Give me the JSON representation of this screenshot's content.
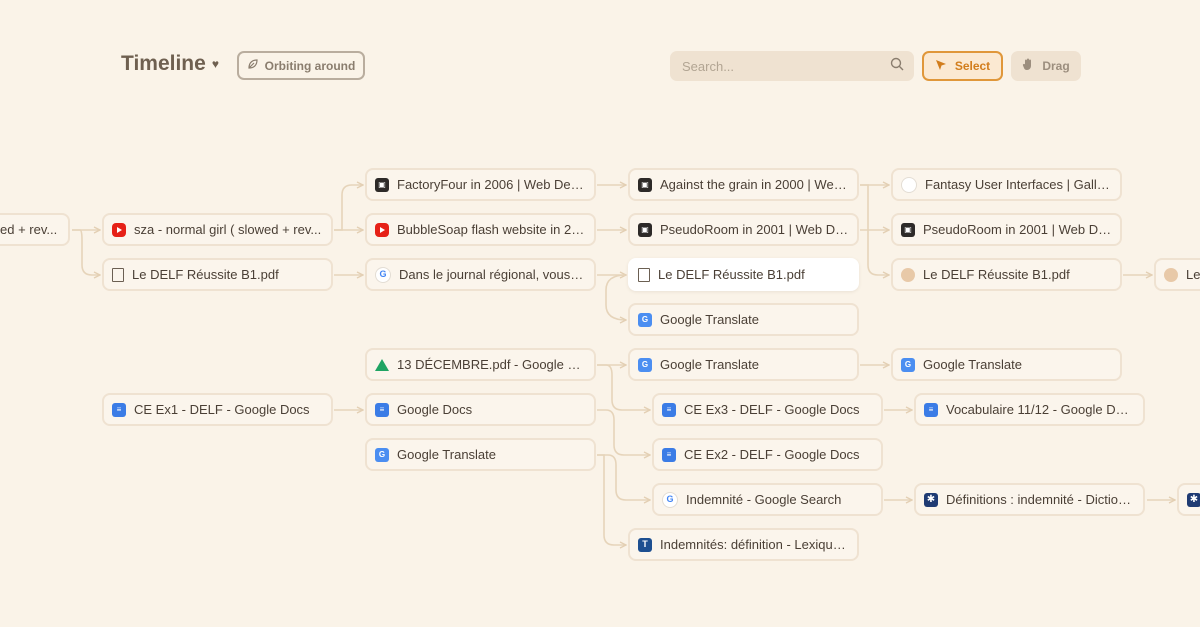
{
  "header": {
    "title": "Timeline",
    "orbit_label": "Orbiting around",
    "search_placeholder": "Search...",
    "select_label": "Select",
    "drag_label": "Drag"
  },
  "nodes": [
    {
      "label": "ed + rev...",
      "icon": "none"
    },
    {
      "label": "sza - normal girl ( slowed + rev...",
      "icon": "youtube-icon"
    },
    {
      "label": "Le DELF Réussite B1.pdf",
      "icon": "file-icon"
    },
    {
      "label": "FactoryFour in 2006 | Web Desi...",
      "icon": "web-design-museum-icon"
    },
    {
      "label": "BubbleSoap flash website in 20...",
      "icon": "youtube-icon"
    },
    {
      "label": "Dans le journal régional, vous lis...",
      "icon": "google-icon"
    },
    {
      "label": "Against the grain in 2000 | Web...",
      "icon": "web-design-museum-icon"
    },
    {
      "label": "PseudoRoom in 2001 | Web Des...",
      "icon": "web-design-museum-icon"
    },
    {
      "label": "Le DELF Réussite B1.pdf",
      "icon": "file-icon"
    },
    {
      "label": "Google Translate",
      "icon": "google-translate-icon"
    },
    {
      "label": "Fantasy User Interfaces | Galler...",
      "icon": "faint-globe-icon"
    },
    {
      "label": "PseudoRoom in 2001 | Web Des...",
      "icon": "web-design-museum-icon"
    },
    {
      "label": "Le DELF Réussite B1.pdf",
      "icon": "avatar-icon"
    },
    {
      "label": "Le",
      "icon": "avatar-icon"
    },
    {
      "label": "13 DÉCEMBRE.pdf - Google Drive",
      "icon": "google-drive-icon"
    },
    {
      "label": "Google Translate",
      "icon": "google-translate-icon"
    },
    {
      "label": "Google Translate",
      "icon": "google-translate-icon"
    },
    {
      "label": "CE Ex1 - DELF - Google Docs",
      "icon": "google-docs-icon"
    },
    {
      "label": "Google Docs",
      "icon": "google-docs-icon"
    },
    {
      "label": "CE Ex3 - DELF - Google Docs",
      "icon": "google-docs-icon"
    },
    {
      "label": "Vocabulaire 11/12 - Google Docs",
      "icon": "google-docs-icon"
    },
    {
      "label": "CE Ex2 - DELF - Google Docs",
      "icon": "google-docs-icon"
    },
    {
      "label": "Google Translate",
      "icon": "google-translate-icon"
    },
    {
      "label": "Indemnité - Google Search",
      "icon": "google-icon"
    },
    {
      "label": "Définitions : indemnité - Diction...",
      "icon": "dictionary-icon"
    },
    {
      "label": "",
      "icon": "dictionary-icon"
    },
    {
      "label": "Indemnités: définition - Lexique...",
      "icon": "lexique-icon"
    }
  ]
}
